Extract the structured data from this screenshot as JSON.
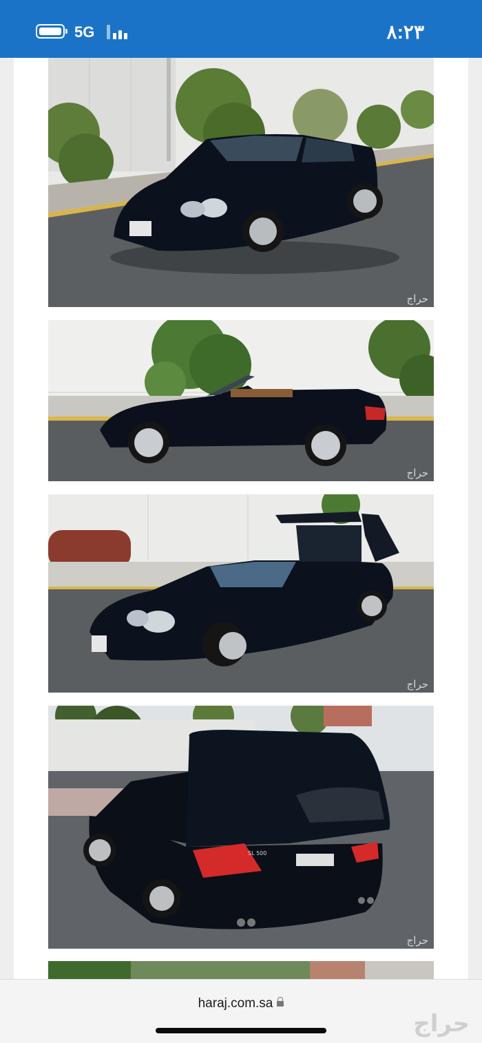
{
  "status_bar": {
    "time": "٨:٢٣",
    "network": "5G"
  },
  "gallery": {
    "photos": [
      {
        "watermark": "حراج"
      },
      {
        "watermark": "حراج"
      },
      {
        "watermark": "حراج"
      },
      {
        "watermark": "حراج"
      }
    ]
  },
  "browser": {
    "url": "haraj.com.sa",
    "brand_watermark": "حراج"
  },
  "colors": {
    "status_bar": "#1b73c8",
    "car_body": "#0c111e"
  },
  "icons": [
    "battery-icon",
    "signal-icon",
    "lock-icon"
  ]
}
